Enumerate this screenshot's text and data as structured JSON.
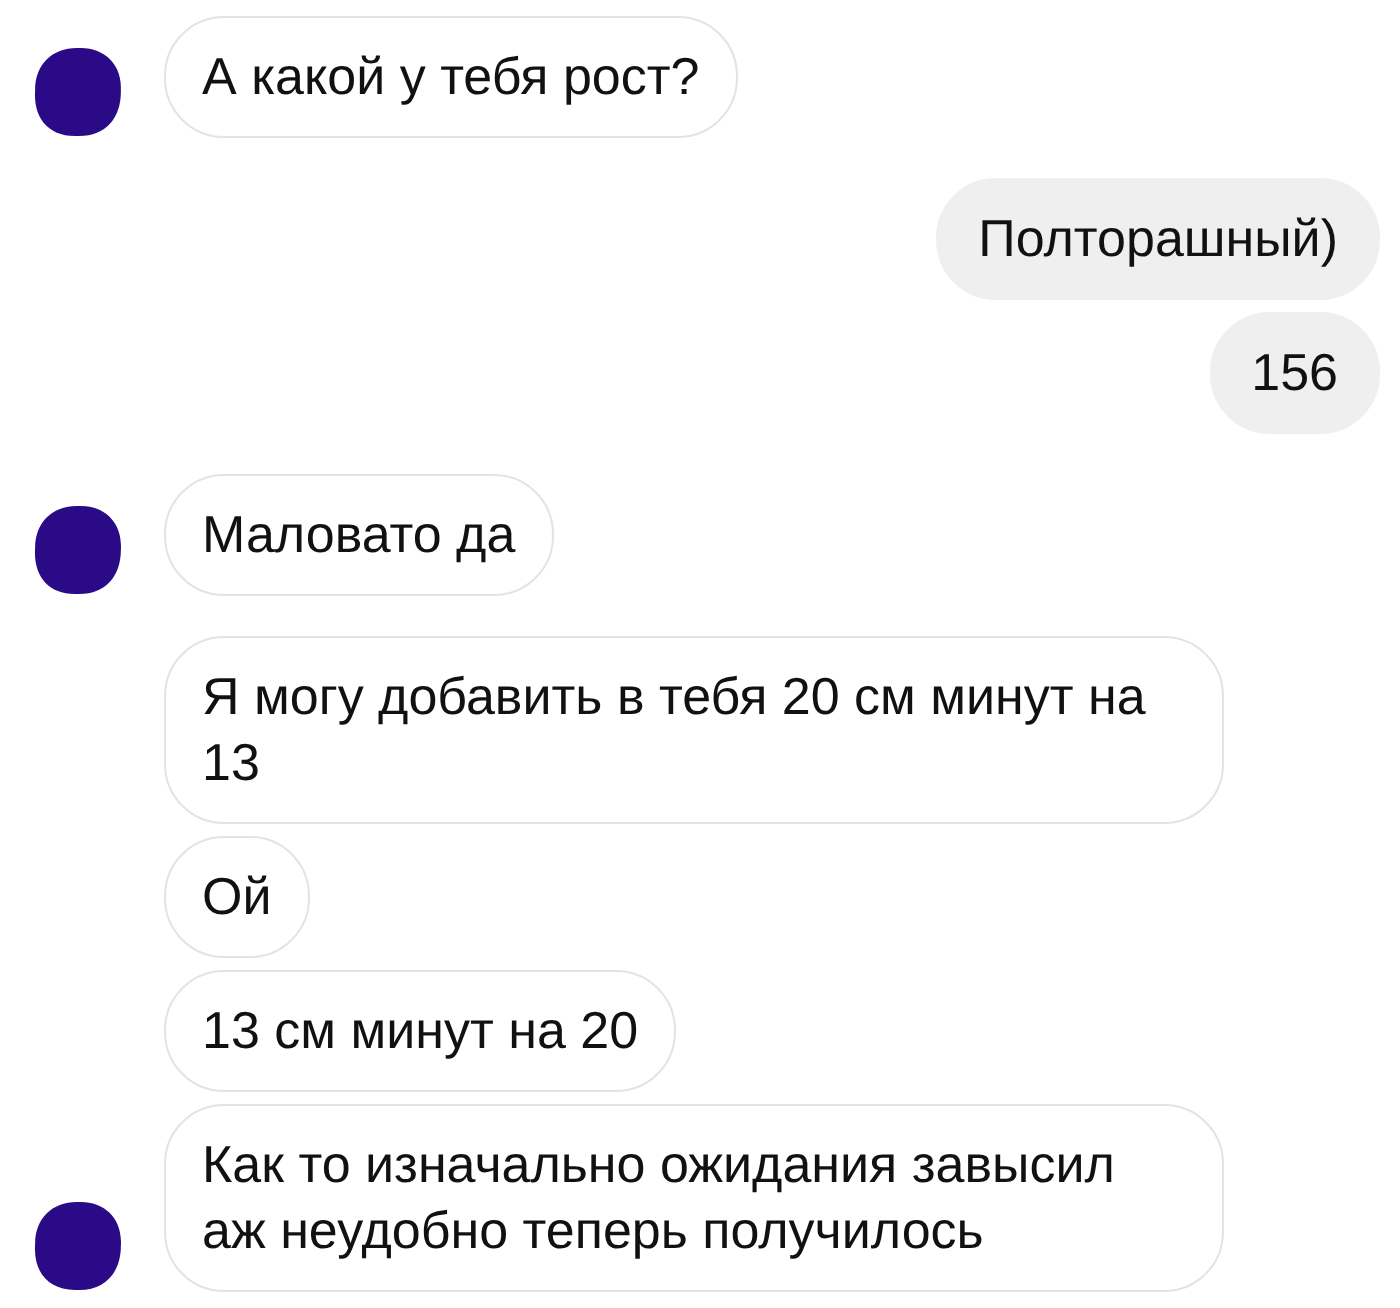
{
  "messages": [
    {
      "kind": "incoming",
      "text": "А какой у тебя рост?",
      "avatar": true
    },
    {
      "kind": "outgoing",
      "text": "Полторашный)"
    },
    {
      "kind": "outgoing",
      "text": "156"
    },
    {
      "kind": "incoming",
      "text": "Маловато да",
      "avatar": true
    },
    {
      "kind": "incoming",
      "text": "Я могу добавить в тебя 20 см минут на 13",
      "avatar": false
    },
    {
      "kind": "incoming",
      "text": "Ой",
      "avatar": false
    },
    {
      "kind": "incoming",
      "text": "13 см минут на 20",
      "avatar": false
    },
    {
      "kind": "incoming",
      "text": "Как то изначально ожидания завысил аж неудобно теперь получилось",
      "avatar": true
    }
  ]
}
